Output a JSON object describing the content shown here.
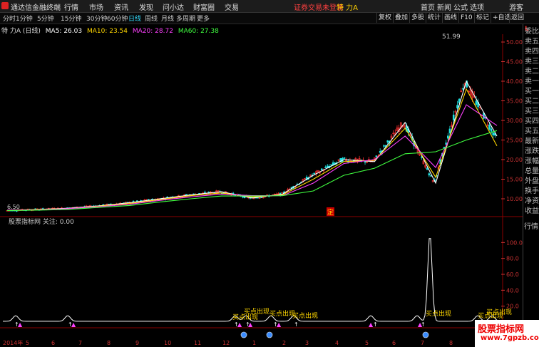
{
  "titlebar": {
    "app_title": "通达信金融终端",
    "menus": [
      "行情",
      "市场",
      "资讯",
      "发现",
      "问小达",
      "财富圈",
      "交易"
    ],
    "login_status": "证券交易未登录",
    "stock_name": "特 力A",
    "right_items": [
      "首页",
      "新闻",
      "公式",
      "选项",
      "游客"
    ]
  },
  "toolbar": {
    "periods": [
      "分时",
      "1分钟",
      "5分钟",
      "15分钟",
      "30分钟",
      "60分钟",
      "日线",
      "周线",
      "月线",
      "多周期",
      "更多"
    ],
    "active_period": "日线",
    "right_buttons": [
      "复权",
      "叠加",
      "多股",
      "统计",
      "画线",
      "F10",
      "标记",
      "+自选",
      "返回"
    ]
  },
  "main_chart": {
    "stock_label": "特 力A (日线)",
    "ma": [
      {
        "label": "MA5: 26.03",
        "color": "#ffffff"
      },
      {
        "label": "MA10: 23.54",
        "color": "#ffd700"
      },
      {
        "label": "MA20: 28.72",
        "color": "#ff40ff"
      },
      {
        "label": "MA60: 27.38",
        "color": "#40ff40"
      }
    ],
    "high_label": "51.99",
    "low_label": "6.50",
    "marker": "定",
    "y_ticks": [
      "50.00",
      "45.00",
      "40.00",
      "35.00",
      "30.00",
      "25.00",
      "20.00",
      "15.00",
      "10.00"
    ]
  },
  "indicator_chart": {
    "label": "股票指标网 关注: 0.00",
    "y_ticks": [
      "100.0",
      "80.0",
      "60.0",
      "40.0",
      "20.0"
    ],
    "signals": [
      "买点出现",
      "买点出现",
      "买点出现",
      "买点出现",
      "买点出现",
      "买点出现",
      "买点出现"
    ]
  },
  "x_axis": [
    "2014年",
    "5",
    "6",
    "7",
    "8",
    "9",
    "10",
    "11",
    "12",
    "1",
    "2",
    "3",
    "4",
    "5",
    "6",
    "7",
    "8"
  ],
  "sidebar_items": [
    "委比",
    "卖五",
    "卖四",
    "卖三",
    "卖二",
    "卖一",
    "买一",
    "买二",
    "买三",
    "买四",
    "买五",
    "最新",
    "涨跌",
    "涨幅",
    "总量",
    "外盘",
    "换手",
    "净资",
    "收益",
    "行情"
  ],
  "watermark": {
    "line1": "股票指标网",
    "line2": "www.7gpzb.com"
  },
  "chart_data": {
    "type": "line",
    "title": "特 力A (日线)",
    "x": [
      "2014-04",
      "2014-05",
      "2014-06",
      "2014-07",
      "2014-08",
      "2014-09",
      "2014-10",
      "2014-11",
      "2014-12",
      "2015-01",
      "2015-02",
      "2015-03",
      "2015-04",
      "2015-05",
      "2015-06",
      "2015-07",
      "2015-08"
    ],
    "series": [
      {
        "name": "MA5",
        "values": [
          7.0,
          7.3,
          7.6,
          8.2,
          9.0,
          10.0,
          11.0,
          11.8,
          10.2,
          11.2,
          16.0,
          20.0,
          19.5,
          29.5,
          14.0,
          40.0,
          26.0
        ]
      },
      {
        "name": "MA10",
        "values": [
          7.1,
          7.3,
          7.5,
          8.1,
          8.8,
          9.8,
          10.8,
          11.5,
          10.5,
          11.0,
          15.0,
          19.5,
          19.8,
          28.0,
          15.5,
          38.0,
          23.5
        ]
      },
      {
        "name": "MA20",
        "values": [
          7.1,
          7.2,
          7.5,
          8.0,
          8.6,
          9.6,
          10.5,
          11.2,
          10.8,
          10.8,
          14.0,
          19.0,
          20.0,
          26.0,
          18.0,
          34.0,
          28.7
        ]
      },
      {
        "name": "MA60",
        "values": [
          7.0,
          7.1,
          7.3,
          7.8,
          8.3,
          9.2,
          10.0,
          10.7,
          10.7,
          10.8,
          12.0,
          16.0,
          17.8,
          21.5,
          22.0,
          25.0,
          27.4
        ]
      }
    ],
    "ylim": [
      8,
      52
    ],
    "indicator": {
      "name": "股票指标网",
      "peak": 110,
      "ylim": [
        0,
        120
      ]
    }
  }
}
